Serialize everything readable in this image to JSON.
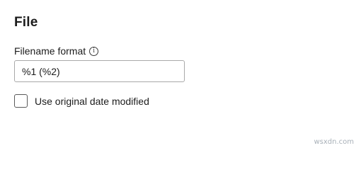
{
  "section": {
    "title": "File"
  },
  "filename_format": {
    "label": "Filename format",
    "info_icon": "info-icon",
    "value": "%1 (%2)"
  },
  "date_option": {
    "label": "Use original date modified",
    "checked": false
  },
  "watermark": "wsxdn.com"
}
